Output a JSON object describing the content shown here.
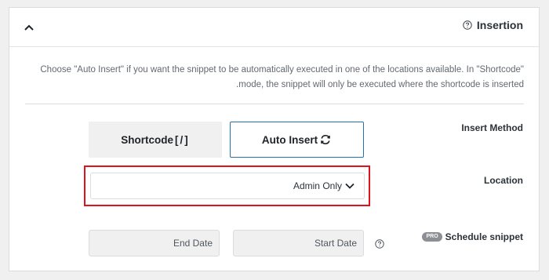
{
  "panel": {
    "title": "Insertion",
    "description": "Choose \"Auto Insert\" if you want the snippet to be automatically executed in one of the locations available. In \"Shortcode\" mode, the snippet will only be executed where the shortcode is inserted."
  },
  "insert_method": {
    "label": "Insert Method",
    "shortcode_label": "Shortcode",
    "shortcode_icon": "[/]",
    "auto_insert_label": "Auto Insert",
    "selected": "Auto Insert"
  },
  "location": {
    "label": "Location",
    "value": "Admin Only"
  },
  "schedule": {
    "label": "Schedule snippet",
    "badge": "PRO",
    "start_date_placeholder": "Start Date",
    "end_date_placeholder": "End Date"
  },
  "colors": {
    "accent": "#2271b1",
    "highlight": "#e0121c"
  }
}
